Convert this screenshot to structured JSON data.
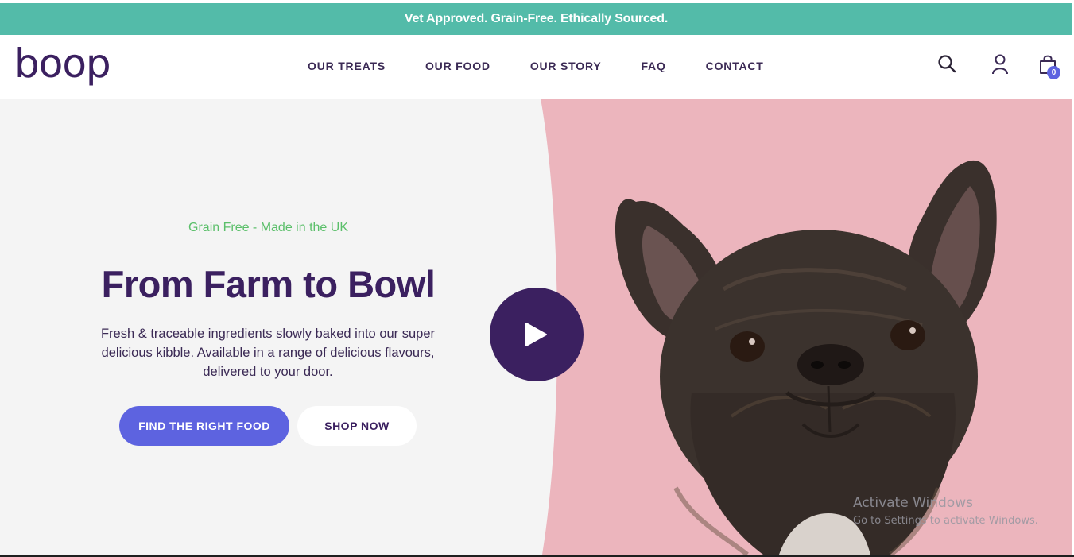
{
  "announcement": {
    "text": "Vet Approved. Grain-Free. Ethically Sourced."
  },
  "brand": {
    "logo_text": "boop"
  },
  "nav": {
    "items": [
      {
        "label": "OUR TREATS"
      },
      {
        "label": "OUR FOOD"
      },
      {
        "label": "OUR STORY"
      },
      {
        "label": "FAQ"
      },
      {
        "label": "CONTACT"
      }
    ]
  },
  "header_icons": {
    "search": "search-icon",
    "account": "user-icon",
    "cart": "shopping-bag-icon",
    "cart_count": "0"
  },
  "hero": {
    "tagline": "Grain Free - Made in the UK",
    "headline": "From Farm to Bowl",
    "description": "Fresh & traceable ingredients slowly baked into our super delicious kibble. Available in a range of delicious flavours, delivered to your door.",
    "primary_cta": "FIND THE RIGHT FOOD",
    "secondary_cta": "SHOP NOW",
    "play_icon": "play-icon"
  },
  "watermark": {
    "title": "Activate Windows",
    "subtitle": "Go to Settings to activate Windows."
  },
  "colors": {
    "announcement_bg": "#53bba9",
    "brand_purple": "#3b2060",
    "accent_blue": "#5d63e0",
    "tagline_green": "#5bbf6a",
    "hero_pink": "#ecb5bd",
    "hero_grey": "#f4f4f4"
  }
}
